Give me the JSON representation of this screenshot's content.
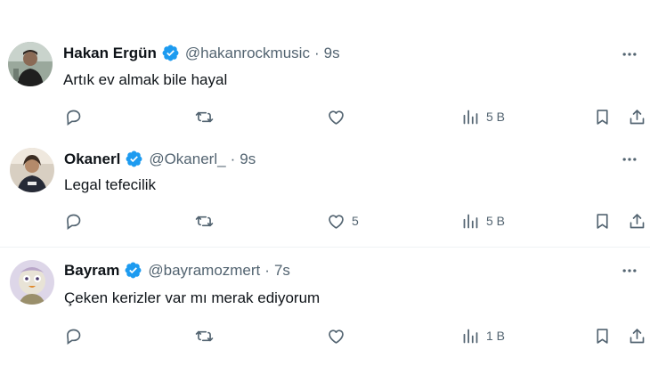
{
  "tweets": [
    {
      "name": "Hakan Ergün",
      "handle": "@hakanrockmusic",
      "separator": "·",
      "time": "9s",
      "text": "Artık ev almak bile hayal",
      "likes": "",
      "views": "5 B"
    },
    {
      "name": "Okanerl",
      "handle": "@Okanerl_",
      "separator": "·",
      "time": "9s",
      "text": "Legal tefecilik",
      "likes": "5",
      "views": "5 B"
    },
    {
      "name": "Bayram",
      "handle": "@bayramozmert",
      "separator": "·",
      "time": "7s",
      "text": "Çeken kerizler var mı merak ediyorum",
      "likes": "",
      "views": "1 B"
    }
  ],
  "colors": {
    "verified": "#1d9bf0",
    "muted": "#536471",
    "text": "#0f1419",
    "divider": "#eff3f4"
  },
  "icons": [
    "reply-icon",
    "retweet-icon",
    "like-icon",
    "views-icon",
    "bookmark-icon",
    "share-icon",
    "more-icon",
    "verified-badge-icon"
  ]
}
